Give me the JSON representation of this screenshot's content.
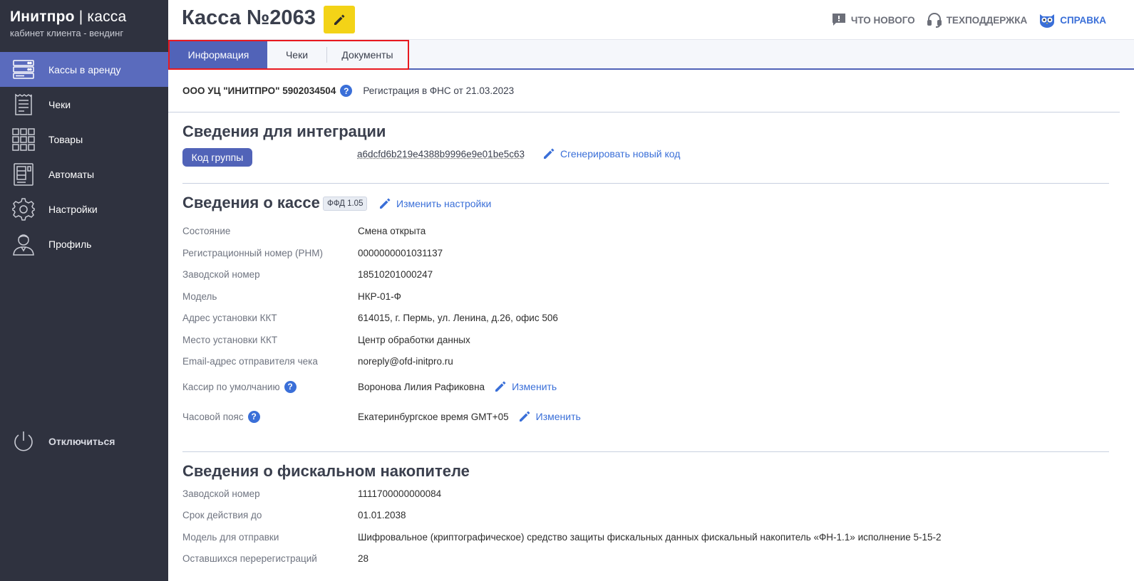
{
  "brand": {
    "name_bold": "Инитпро",
    "separator": "|",
    "name_light": "касса",
    "subtitle": "кабинет клиента - вендинг"
  },
  "sidebar": {
    "items": [
      {
        "label": "Кассы в аренду",
        "icon": "server-icon",
        "active": true
      },
      {
        "label": "Чеки",
        "icon": "receipt-icon",
        "active": false
      },
      {
        "label": "Товары",
        "icon": "grid-icon",
        "active": false
      },
      {
        "label": "Автоматы",
        "icon": "vending-machine-icon",
        "active": false
      },
      {
        "label": "Настройки",
        "icon": "gear-icon",
        "active": false
      },
      {
        "label": "Профиль",
        "icon": "user-icon",
        "active": false
      }
    ],
    "logout": {
      "label": "Отключиться",
      "icon": "power-icon"
    }
  },
  "header": {
    "title": "Касса №2063",
    "links": [
      {
        "label": "ЧТО НОВОГО",
        "icon": "chat-exclamation-icon"
      },
      {
        "label": "ТЕХПОДДЕРЖКА",
        "icon": "headset-icon"
      },
      {
        "label": "СПРАВКА",
        "icon": "owl-icon"
      }
    ]
  },
  "tabs": [
    {
      "label": "Информация",
      "active": true
    },
    {
      "label": "Чеки",
      "active": false
    },
    {
      "label": "Документы",
      "active": false
    }
  ],
  "org": {
    "name": "ООО УЦ \"ИНИТПРО\" 5902034504",
    "registration": "Регистрация в ФНС от 21.03.2023"
  },
  "integration": {
    "title": "Сведения для интеграции",
    "group_label": "Код группы",
    "group_code": "a6dcfd6b219e4388b9996e9e01be5c63",
    "generate_label": "Сгенерировать новый код"
  },
  "kassa": {
    "title": "Сведения о кассе",
    "ffd": "ФФД 1.05",
    "settings_label": "Изменить настройки",
    "rows": [
      {
        "label": "Состояние",
        "value": "Смена открыта"
      },
      {
        "label": "Регистрационный номер (РНМ)",
        "value": "0000000001031137"
      },
      {
        "label": "Заводской номер",
        "value": "18510201000247"
      },
      {
        "label": "Модель",
        "value": "НКР-01-Ф"
      },
      {
        "label": "Адрес установки ККТ",
        "value": "614015, г. Пермь, ул. Ленина, д.26, офис 506"
      },
      {
        "label": "Место установки ККТ",
        "value": "Центр обработки данных"
      },
      {
        "label": "Email-адрес отправителя чека",
        "value": "noreply@ofd-initpro.ru"
      }
    ],
    "cashier": {
      "label": "Кассир по умолчанию",
      "value": "Воронова Лилия Рафиковна",
      "action": "Изменить"
    },
    "timezone": {
      "label": "Часовой пояс",
      "value": "Екатеринбургское время GMT+05",
      "action": "Изменить"
    }
  },
  "fn": {
    "title": "Сведения о фискальном накопителе",
    "rows": [
      {
        "label": "Заводской номер",
        "value": "1111700000000084"
      },
      {
        "label": "Срок действия до",
        "value": "01.01.2038"
      },
      {
        "label": "Модель для отправки",
        "value": "Шифровальное (криптографическое) средство защиты фискальных данных фискальный накопитель «ФН-1.1» исполнение 5-15-2"
      },
      {
        "label": "Оставшихся перерегистраций",
        "value": "28"
      }
    ]
  },
  "colors": {
    "sidebar": "#2f323f",
    "accent": "#5163b8",
    "link": "#3a6fd8",
    "edit_button": "#f3d317",
    "tab_highlight": "#e8191f"
  }
}
